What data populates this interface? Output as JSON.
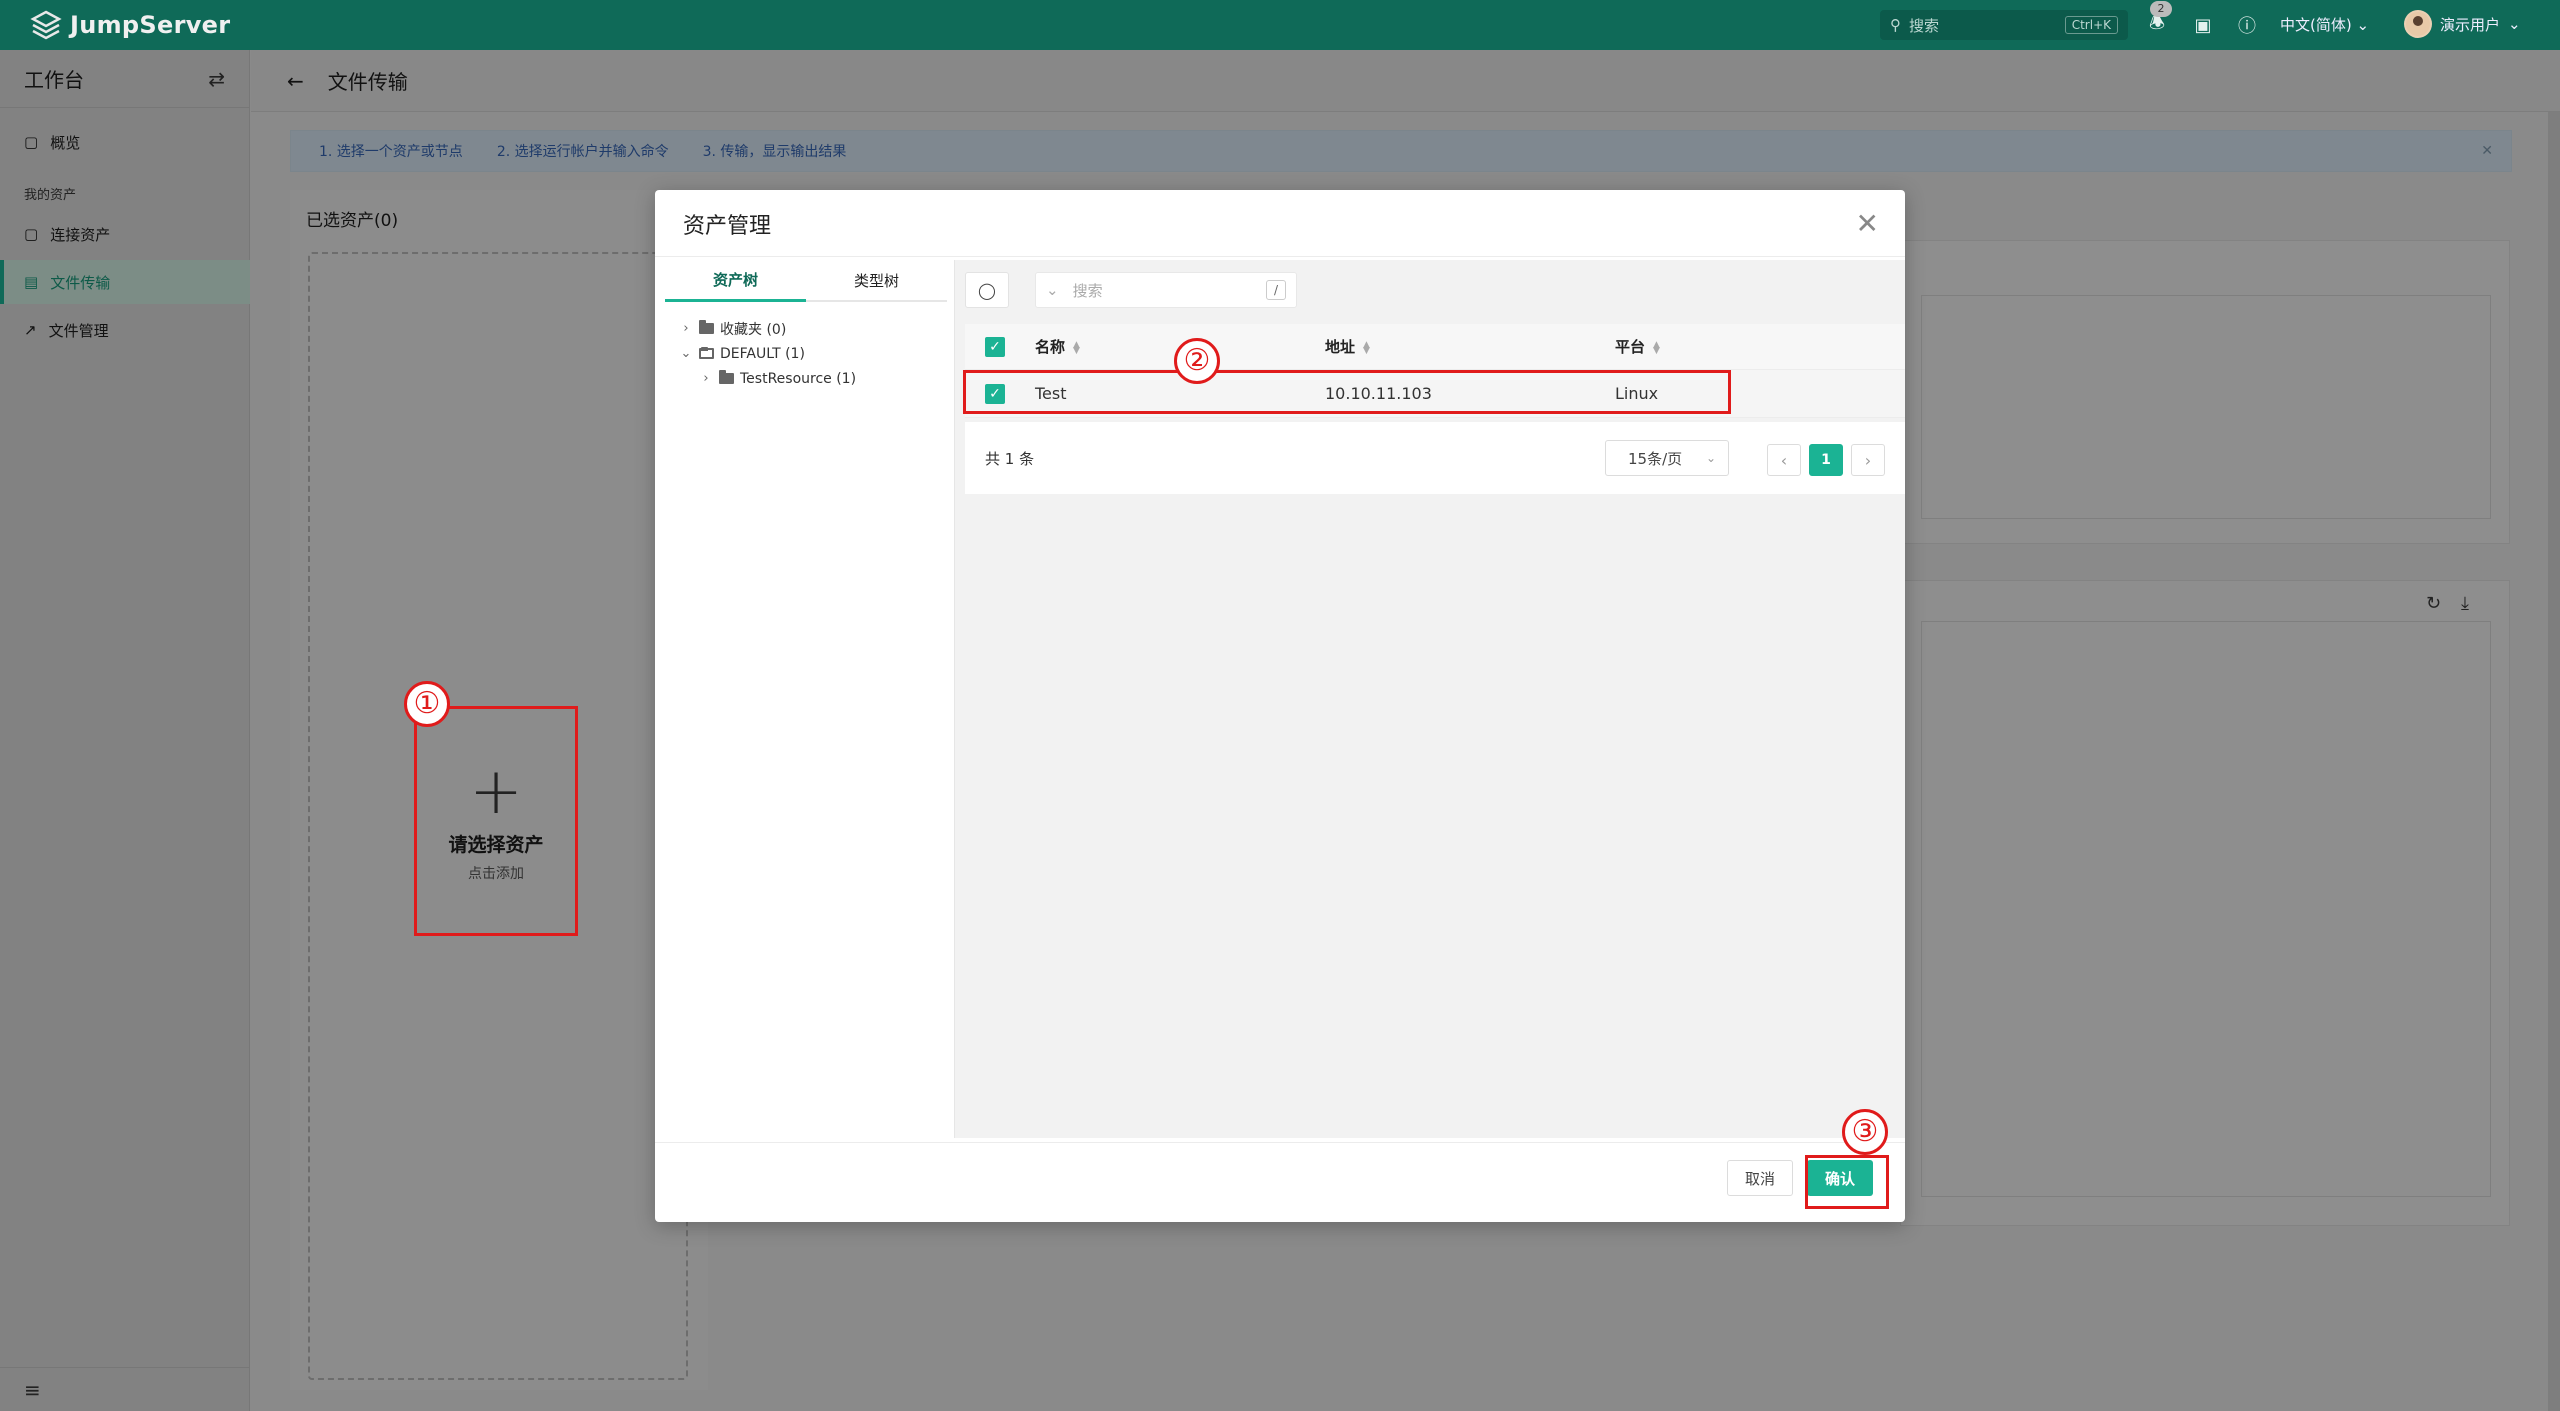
{
  "app": {
    "name": "JumpServer"
  },
  "topbar": {
    "search_placeholder": "搜索",
    "search_shortcut": "Ctrl+K",
    "notification_count": "2",
    "language": "中文(简体)",
    "username": "演示用户"
  },
  "sidebar": {
    "title": "工作台",
    "items": [
      {
        "label": "概览",
        "icon": "monitor-icon"
      },
      {
        "label": "连接资产",
        "icon": "monitor-icon"
      },
      {
        "label": "文件传输",
        "icon": "file-icon"
      },
      {
        "label": "文件管理",
        "icon": "external-link-icon"
      }
    ],
    "group_label": "我的资产"
  },
  "page": {
    "title": "文件传输",
    "steps": [
      "1. 选择一个资产或节点",
      "2. 选择运行帐户并输入命令",
      "3. 传输，显示输出结果"
    ],
    "selected_assets_label": "已选资产(0)",
    "add_asset_title": "请选择资产",
    "add_asset_hint": "点击添加"
  },
  "modal": {
    "title": "资产管理",
    "tabs": [
      "资产树",
      "类型树"
    ],
    "tree": [
      {
        "label": "收藏夹 (0)"
      },
      {
        "label": "DEFAULT (1)"
      },
      {
        "label": "TestResource (1)"
      }
    ],
    "search_placeholder": "搜索",
    "search_shortcut": "/",
    "columns": {
      "name": "名称",
      "address": "地址",
      "platform": "平台"
    },
    "rows": [
      {
        "name": "Test",
        "address": "10.10.11.103",
        "platform": "Linux",
        "checked": true
      }
    ],
    "total_text": "共 1 条",
    "page_size": "15条/页",
    "current_page": "1",
    "cancel_label": "取消",
    "confirm_label": "确认"
  },
  "annotations": [
    "①",
    "②",
    "③"
  ],
  "colors": {
    "brand": "#0f6a58",
    "accent": "#1bb394",
    "highlight": "#e01b1b"
  }
}
